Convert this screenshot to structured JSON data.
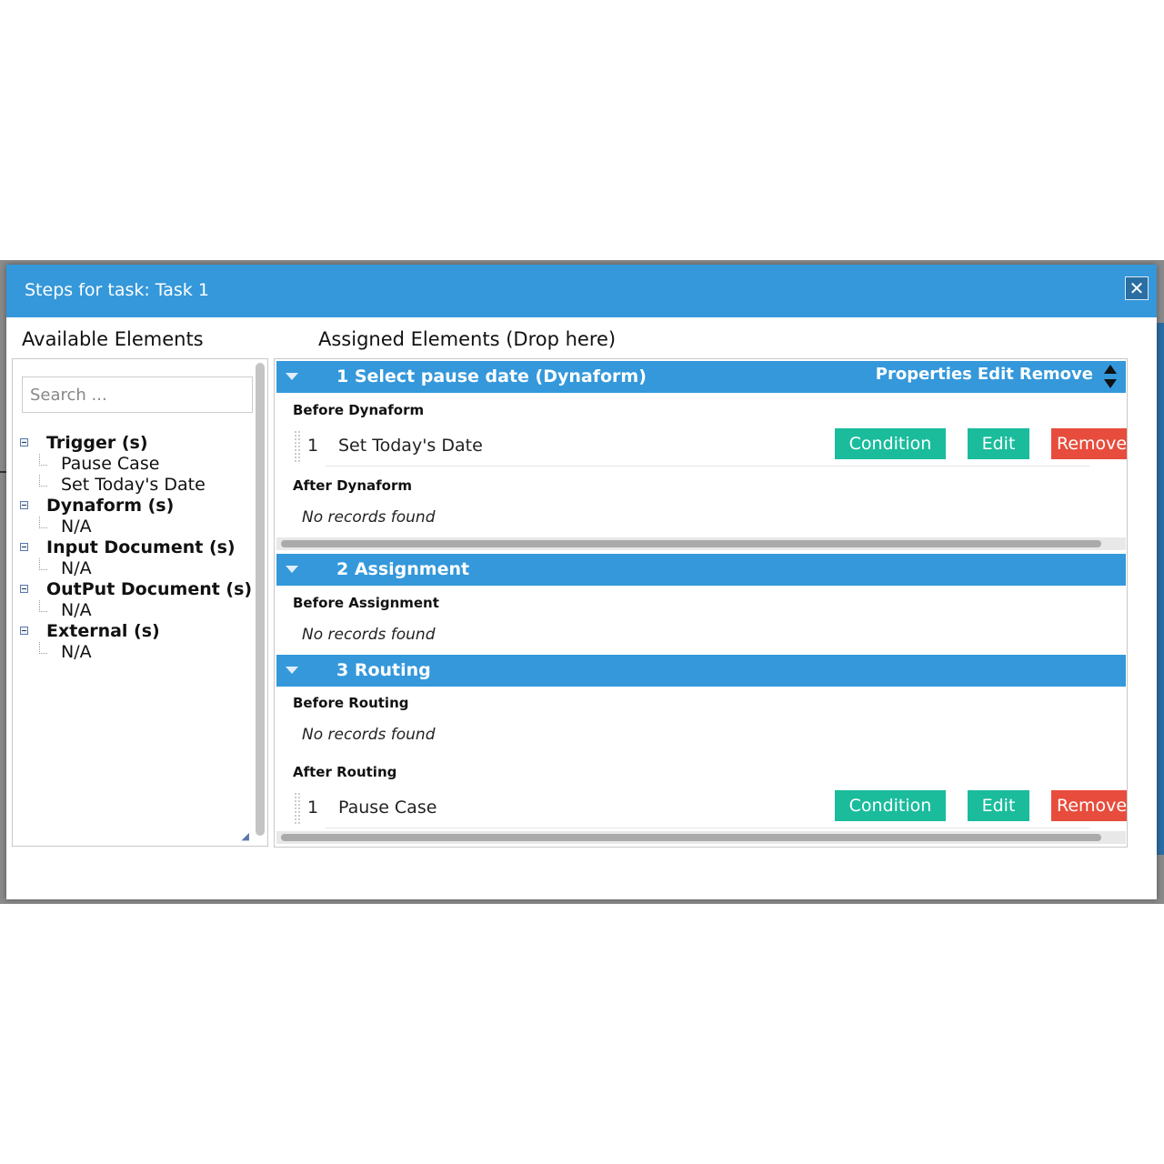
{
  "modal": {
    "title": "Steps for task: Task 1",
    "close_icon": "close-icon"
  },
  "left": {
    "title": "Available Elements",
    "search_placeholder": "Search ...",
    "groups": [
      {
        "label": "Trigger (s)",
        "items": [
          "Pause Case",
          "Set Today's Date"
        ]
      },
      {
        "label": "Dynaform (s)",
        "items": [
          "N/A"
        ]
      },
      {
        "label": "Input Document (s)",
        "items": [
          "N/A"
        ]
      },
      {
        "label": "OutPut Document (s)",
        "items": [
          "N/A"
        ]
      },
      {
        "label": "External (s)",
        "items": [
          "N/A"
        ]
      }
    ]
  },
  "right": {
    "title": "Assigned Elements (Drop here)",
    "actions": {
      "properties": "Properties",
      "edit": "Edit",
      "remove": "Remove"
    },
    "steps": [
      {
        "title": "1 Select pause date (Dynaform)",
        "before_label": "Before Dynaform",
        "before_rows": [
          {
            "num": "1",
            "name": "Set Today's Date"
          }
        ],
        "after_label": "After Dynaform",
        "after_empty": "No records found"
      },
      {
        "title": "2 Assignment",
        "before_label": "Before Assignment",
        "before_empty": "No records found"
      },
      {
        "title": "3 Routing",
        "before_label": "Before Routing",
        "before_empty": "No records found",
        "after_label": "After Routing",
        "after_rows": [
          {
            "num": "1",
            "name": "Pause Case"
          }
        ]
      }
    ],
    "row_buttons": {
      "condition": "Condition",
      "edit": "Edit",
      "remove": "Remove"
    }
  },
  "colors": {
    "header_blue": "#3498db",
    "button_teal": "#1abc9c",
    "button_red": "#e74c3c"
  }
}
